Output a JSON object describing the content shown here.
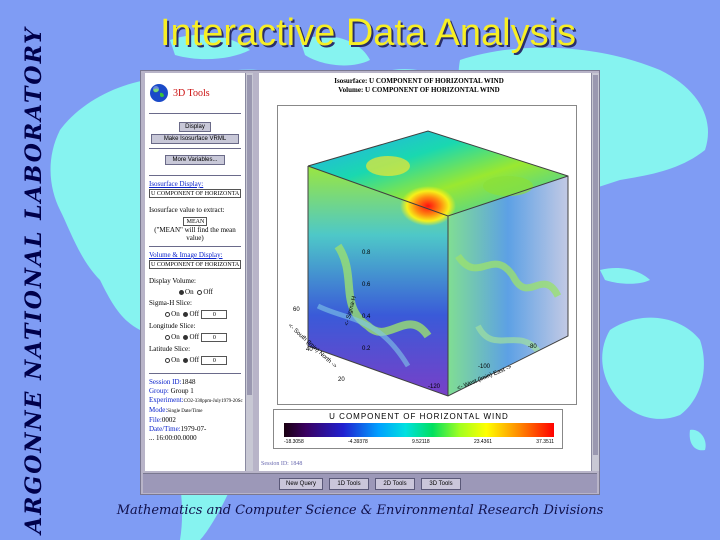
{
  "slide": {
    "title": "Interactive Data Analysis",
    "side_label": "ARGONNE  NATIONAL  LABORATORY",
    "footer": "Mathematics and Computer Science & Environmental Research Divisions"
  },
  "colors": {
    "background": "#7f9cf4",
    "title": "#f7ef24",
    "map_land": "#86f3f0"
  },
  "left_panel": {
    "tools_title": "3D Tools",
    "display_button": "Display",
    "make_vrml_button": "Make Isosurface VRML",
    "more_variables_button": "More Variables...",
    "isosurface_section": "Isosurface Display:",
    "isosurface_selected": "U COMPONENT OF HORIZONTA",
    "iso_value_label": "Isosurface value to extract:",
    "iso_value": "MEAN",
    "iso_help": "(\"MEAN\" will find the mean value)",
    "volume_section": "Volume & Image Display:",
    "volume_selected": "U COMPONENT OF HORIZONTA",
    "display_volume_label": "Display Volume:",
    "on_label": "On",
    "off_label": "Off",
    "sigma_label": "Sigma-H Slice:",
    "sigma_value": "0",
    "longitude_label": "Longitude Slice:",
    "longitude_value": "0",
    "latitude_label": "Latitude Slice:",
    "latitude_value": "0",
    "session_label": "Session ID:",
    "session_value": "1848",
    "group_label": "Group:",
    "group_value": "Group 1",
    "experiment_label": "Experiment:",
    "experiment_value": "CO2-330ppm-July1979-20Sc",
    "mode_label": "Mode:",
    "mode_value": "Single Date/Time",
    "file_label": "File:",
    "file_value": "0002",
    "datetime_label": "Date/Time:",
    "datetime_value": "1979-07-",
    "datetime_cont": "... 16:00:00.0000"
  },
  "viz": {
    "header_line1": "Isosurface: U COMPONENT OF HORIZONTAL WIND",
    "header_line2": "Volume: U COMPONENT OF HORIZONTAL WIND",
    "axis_west_east": "<- West (lmin) East ->",
    "axis_south_north": "<- South (lmin) North ->",
    "axis_sigma": "<- Sigma-H",
    "tick_x_left": "-120",
    "tick_x_mid": "-100",
    "tick_x_right": "-80",
    "tick_y_top": "60",
    "tick_y_mid": "40",
    "tick_y_bot": "20",
    "tick_z_top": "0.8",
    "tick_z_mid": "0.6",
    "tick_z_low": "0.4",
    "tick_z_bot": "0.2",
    "colorbar_title": "U  COMPONENT  OF  HORIZONTAL  WIND",
    "colorbar_ticks": [
      "-18.3058",
      "-4.39378",
      "9.52118",
      "23.4361",
      "37.3511"
    ],
    "status": "Session ID: 1848"
  },
  "bottom_bar": {
    "new_query": "New Query",
    "tools_1d": "1D Tools",
    "tools_2d": "2D Tools",
    "tools_3d": "3D Tools"
  }
}
